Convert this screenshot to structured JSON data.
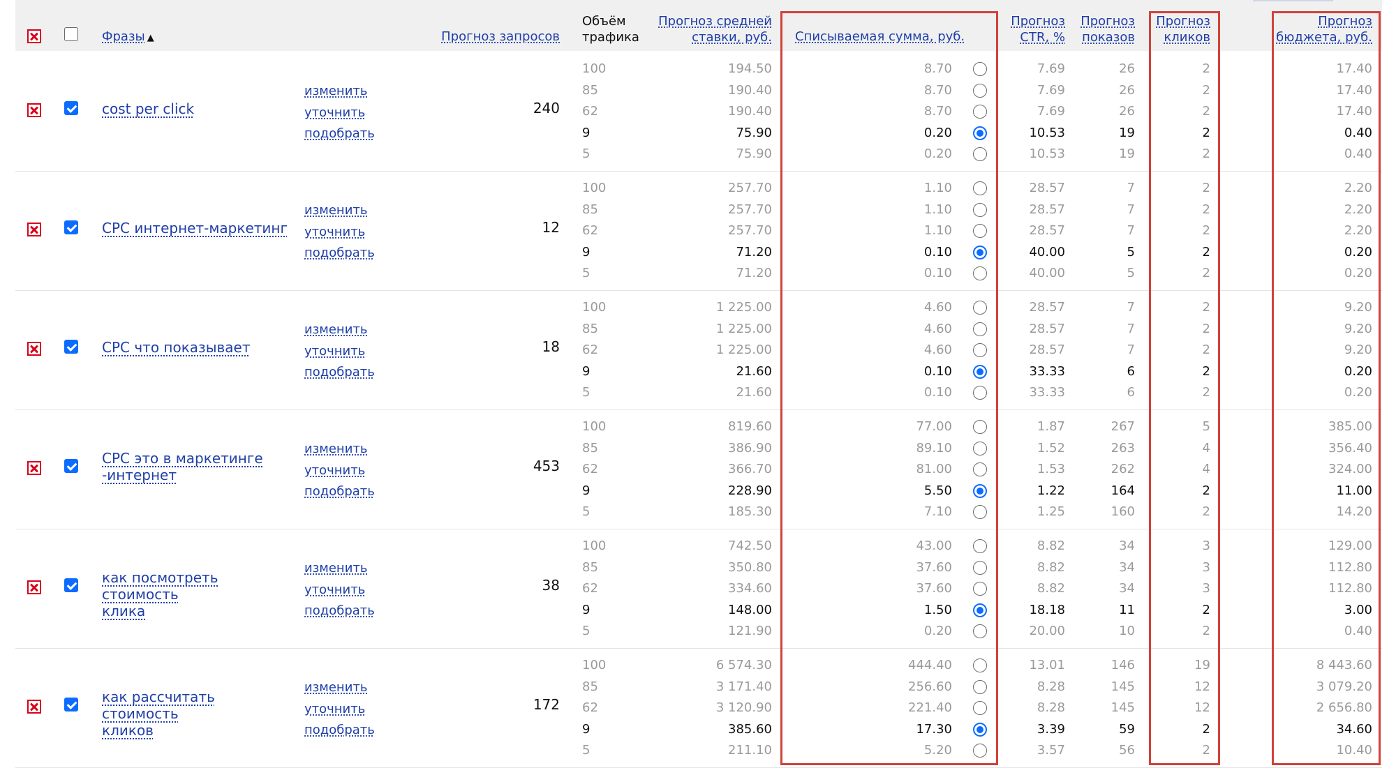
{
  "header": {
    "phrases_label": "Фразы",
    "sort_indicator": "▲",
    "requests_label": "Прогноз запросов",
    "traffic_line1": "Объём",
    "traffic_line2": "трафика",
    "avg_bid_line1": "Прогноз средней",
    "avg_bid_line2": "ставки, руб.",
    "charged_sum": "Списываемая сумма, руб.",
    "ctr_line1": "Прогноз",
    "ctr_line2": "CTR, %",
    "impressions_line1": "Прогноз",
    "impressions_line2": "показов",
    "clicks_line1": "Прогноз",
    "clicks_line2": "кликов",
    "budget_line1": "Прогноз",
    "budget_line2": "бюджета, руб."
  },
  "actions": [
    "изменить",
    "уточнить",
    "подобрать"
  ],
  "colors": {
    "link": "#1f3fa8",
    "delete_red": "#d9001b",
    "checkbox_blue": "#0b6cff",
    "highlight_frame": "#d0423a",
    "header_bg": "#f0f0f0",
    "muted_text": "#9a9a9a"
  },
  "icons": {
    "delete": "delete-x-icon",
    "checkbox": "checkbox-icon",
    "radio": "radio-icon",
    "sort": "sort-asc-icon"
  },
  "rows": [
    {
      "phrase_lines": [
        "cost per click"
      ],
      "requests": "240",
      "checked": true,
      "selected_index": 3,
      "traffic": [
        "100",
        "85",
        "62",
        "9",
        "5"
      ],
      "avg_bid": [
        "194.50",
        "190.40",
        "190.40",
        "75.90",
        "75.90"
      ],
      "charged_sum": [
        "8.70",
        "8.70",
        "8.70",
        "0.20",
        "0.20"
      ],
      "ctr": [
        "7.69",
        "7.69",
        "7.69",
        "10.53",
        "10.53"
      ],
      "impressions": [
        "26",
        "26",
        "26",
        "19",
        "19"
      ],
      "clicks": [
        "2",
        "2",
        "2",
        "2",
        "2"
      ],
      "budget": [
        "17.40",
        "17.40",
        "17.40",
        "0.40",
        "0.40"
      ]
    },
    {
      "phrase_lines": [
        "CPC интернет-маркетинг"
      ],
      "requests": "12",
      "checked": true,
      "selected_index": 3,
      "traffic": [
        "100",
        "85",
        "62",
        "9",
        "5"
      ],
      "avg_bid": [
        "257.70",
        "257.70",
        "257.70",
        "71.20",
        "71.20"
      ],
      "charged_sum": [
        "1.10",
        "1.10",
        "1.10",
        "0.10",
        "0.10"
      ],
      "ctr": [
        "28.57",
        "28.57",
        "28.57",
        "40.00",
        "40.00"
      ],
      "impressions": [
        "7",
        "7",
        "7",
        "5",
        "5"
      ],
      "clicks": [
        "2",
        "2",
        "2",
        "2",
        "2"
      ],
      "budget": [
        "2.20",
        "2.20",
        "2.20",
        "0.20",
        "0.20"
      ]
    },
    {
      "phrase_lines": [
        "CPC что показывает"
      ],
      "requests": "18",
      "checked": true,
      "selected_index": 3,
      "traffic": [
        "100",
        "85",
        "62",
        "9",
        "5"
      ],
      "avg_bid": [
        "1 225.00",
        "1 225.00",
        "1 225.00",
        "21.60",
        "21.60"
      ],
      "charged_sum": [
        "4.60",
        "4.60",
        "4.60",
        "0.10",
        "0.10"
      ],
      "ctr": [
        "28.57",
        "28.57",
        "28.57",
        "33.33",
        "33.33"
      ],
      "impressions": [
        "7",
        "7",
        "7",
        "6",
        "6"
      ],
      "clicks": [
        "2",
        "2",
        "2",
        "2",
        "2"
      ],
      "budget": [
        "9.20",
        "9.20",
        "9.20",
        "0.20",
        "0.20"
      ]
    },
    {
      "phrase_lines": [
        "CPC это в маркетинге",
        "-интернет"
      ],
      "requests": "453",
      "checked": true,
      "selected_index": 3,
      "traffic": [
        "100",
        "85",
        "62",
        "9",
        "5"
      ],
      "avg_bid": [
        "819.60",
        "386.90",
        "366.70",
        "228.90",
        "185.30"
      ],
      "charged_sum": [
        "77.00",
        "89.10",
        "81.00",
        "5.50",
        "7.10"
      ],
      "ctr": [
        "1.87",
        "1.52",
        "1.53",
        "1.22",
        "1.25"
      ],
      "impressions": [
        "267",
        "263",
        "262",
        "164",
        "160"
      ],
      "clicks": [
        "5",
        "4",
        "4",
        "2",
        "2"
      ],
      "budget": [
        "385.00",
        "356.40",
        "324.00",
        "11.00",
        "14.20"
      ]
    },
    {
      "phrase_lines": [
        "как посмотреть стоимость",
        "клика"
      ],
      "requests": "38",
      "checked": true,
      "selected_index": 3,
      "traffic": [
        "100",
        "85",
        "62",
        "9",
        "5"
      ],
      "avg_bid": [
        "742.50",
        "350.80",
        "334.60",
        "148.00",
        "121.90"
      ],
      "charged_sum": [
        "43.00",
        "37.60",
        "37.60",
        "1.50",
        "0.20"
      ],
      "ctr": [
        "8.82",
        "8.82",
        "8.82",
        "18.18",
        "20.00"
      ],
      "impressions": [
        "34",
        "34",
        "34",
        "11",
        "10"
      ],
      "clicks": [
        "3",
        "3",
        "3",
        "2",
        "2"
      ],
      "budget": [
        "129.00",
        "112.80",
        "112.80",
        "3.00",
        "0.40"
      ]
    },
    {
      "phrase_lines": [
        "как рассчитать стоимость",
        "кликов"
      ],
      "requests": "172",
      "checked": true,
      "selected_index": 3,
      "traffic": [
        "100",
        "85",
        "62",
        "9",
        "5"
      ],
      "avg_bid": [
        "6 574.30",
        "3 171.40",
        "3 120.90",
        "385.60",
        "211.10"
      ],
      "charged_sum": [
        "444.40",
        "256.60",
        "221.40",
        "17.30",
        "5.20"
      ],
      "ctr": [
        "13.01",
        "8.28",
        "8.28",
        "3.39",
        "3.57"
      ],
      "impressions": [
        "146",
        "145",
        "145",
        "59",
        "56"
      ],
      "clicks": [
        "19",
        "12",
        "12",
        "2",
        "2"
      ],
      "budget": [
        "8 443.60",
        "3 079.20",
        "2 656.80",
        "34.60",
        "10.40"
      ]
    }
  ]
}
